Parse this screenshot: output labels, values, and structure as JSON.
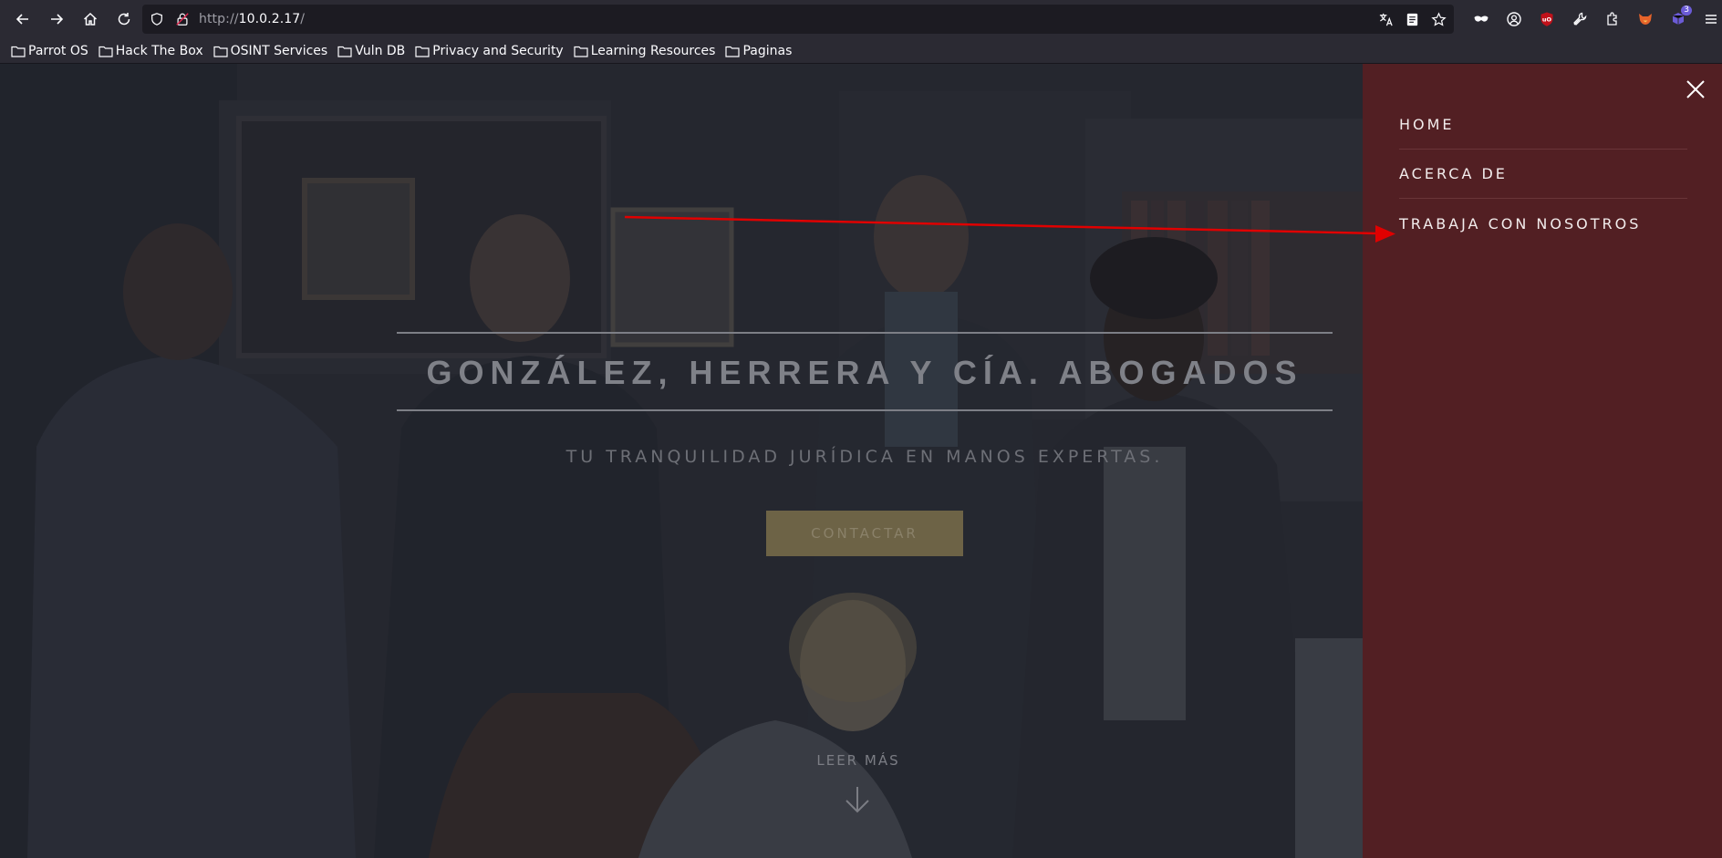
{
  "browser": {
    "url_protocol": "http://",
    "url_host": "10.0.2.17",
    "url_path": "/",
    "extension_badge": "3"
  },
  "bookmarks": [
    {
      "label": "Parrot OS"
    },
    {
      "label": "Hack The Box"
    },
    {
      "label": "OSINT Services"
    },
    {
      "label": "Vuln DB"
    },
    {
      "label": "Privacy and Security"
    },
    {
      "label": "Learning Resources"
    },
    {
      "label": "Paginas"
    }
  ],
  "hero": {
    "title": "GONZÁLEZ, HERRERA Y CÍA. ABOGADOS",
    "subtitle": "TU TRANQUILIDAD JURÍDICA EN MANOS EXPERTAS.",
    "cta_label": "CONTACTAR",
    "read_more_label": "LEER MÁS"
  },
  "side_menu": {
    "items": [
      {
        "label": "HOME"
      },
      {
        "label": "ACERCA DE"
      },
      {
        "label": "TRABAJA CON NOSOTROS"
      }
    ]
  },
  "colors": {
    "menu_bg": "#521f23",
    "cta_bg": "#6d6346",
    "annotation_arrow": "#e00000"
  }
}
